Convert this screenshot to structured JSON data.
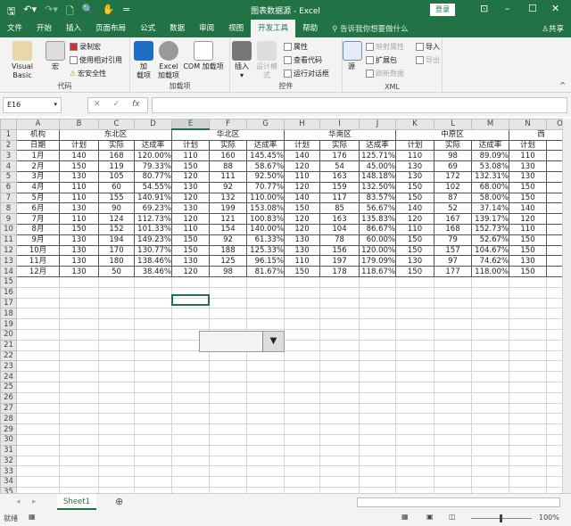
{
  "titlebar": {
    "title": "图表数据源  -  Excel",
    "login": "登录",
    "quick_access": [
      "save-icon",
      "undo-icon",
      "redo-icon",
      "new-icon",
      "print-preview-icon",
      "touch-mode-icon",
      "customize-icon"
    ]
  },
  "tabs": [
    "文件",
    "开始",
    "插入",
    "页面布局",
    "公式",
    "数据",
    "审阅",
    "视图",
    "开发工具",
    "帮助"
  ],
  "active_tab": "开发工具",
  "tell_me": "告诉我你想要做什么",
  "share": "共享",
  "ribbon": {
    "code": {
      "label": "代码",
      "visual_basic": "Visual Basic",
      "macro": "宏",
      "record": "录制宏",
      "relative": "使用相对引用",
      "security": "宏安全性"
    },
    "addins": {
      "label": "加载项",
      "addin": "加\n载项",
      "excel_addin": "Excel\n加载项",
      "com_addin": "COM 加载项"
    },
    "controls": {
      "label": "控件",
      "insert": "插入",
      "design": "设计模式",
      "properties": "属性",
      "view_code": "查看代码",
      "run_dialog": "运行对话框"
    },
    "xml": {
      "label": "XML",
      "source": "源",
      "map_props": "映射属性",
      "expansion": "扩展包",
      "refresh": "刷新数据",
      "import": "导入",
      "export": "导出"
    }
  },
  "formula": {
    "name_box": "E16",
    "cancel": "✕",
    "enter": "✓",
    "fx": "fx",
    "value": ""
  },
  "columns": [
    "A",
    "B",
    "C",
    "D",
    "E",
    "F",
    "G",
    "H",
    "I",
    "J",
    "K",
    "L",
    "M",
    "N",
    "O"
  ],
  "selected_column": "E",
  "header_row1": {
    "A": "机构",
    "regions": [
      "东北区",
      "华北区",
      "华南区",
      "中原区",
      "西"
    ]
  },
  "header_row2": [
    "日期",
    "计划",
    "实际",
    "达成率",
    "计划",
    "实际",
    "达成率",
    "计划",
    "实际",
    "达成率",
    "计划",
    "实际",
    "达成率",
    "计划"
  ],
  "rows": [
    [
      "1月",
      "140",
      "168",
      "120.00%",
      "110",
      "160",
      "145.45%",
      "140",
      "176",
      "125.71%",
      "110",
      "98",
      "89.09%",
      "110"
    ],
    [
      "2月",
      "150",
      "119",
      "79.33%",
      "150",
      "88",
      "58.67%",
      "120",
      "54",
      "45.00%",
      "130",
      "69",
      "53.08%",
      "130"
    ],
    [
      "3月",
      "130",
      "105",
      "80.77%",
      "120",
      "111",
      "92.50%",
      "110",
      "163",
      "148.18%",
      "130",
      "172",
      "132.31%",
      "130"
    ],
    [
      "4月",
      "110",
      "60",
      "54.55%",
      "130",
      "92",
      "70.77%",
      "120",
      "159",
      "132.50%",
      "150",
      "102",
      "68.00%",
      "150"
    ],
    [
      "5月",
      "110",
      "155",
      "140.91%",
      "120",
      "132",
      "110.00%",
      "140",
      "117",
      "83.57%",
      "150",
      "87",
      "58.00%",
      "150"
    ],
    [
      "6月",
      "130",
      "90",
      "69.23%",
      "130",
      "199",
      "153.08%",
      "150",
      "85",
      "56.67%",
      "140",
      "52",
      "37.14%",
      "140"
    ],
    [
      "7月",
      "110",
      "124",
      "112.73%",
      "120",
      "121",
      "100.83%",
      "120",
      "163",
      "135.83%",
      "120",
      "167",
      "139.17%",
      "120"
    ],
    [
      "8月",
      "150",
      "152",
      "101.33%",
      "110",
      "154",
      "140.00%",
      "120",
      "104",
      "86.67%",
      "110",
      "168",
      "152.73%",
      "110"
    ],
    [
      "9月",
      "130",
      "194",
      "149.23%",
      "150",
      "92",
      "61.33%",
      "130",
      "78",
      "60.00%",
      "150",
      "79",
      "52.67%",
      "150"
    ],
    [
      "10月",
      "130",
      "170",
      "130.77%",
      "150",
      "188",
      "125.33%",
      "130",
      "156",
      "120.00%",
      "150",
      "157",
      "104.67%",
      "150"
    ],
    [
      "11月",
      "130",
      "180",
      "138.46%",
      "130",
      "125",
      "96.15%",
      "110",
      "197",
      "179.09%",
      "130",
      "97",
      "74.62%",
      "130"
    ],
    [
      "12月",
      "130",
      "50",
      "38.46%",
      "120",
      "98",
      "81.67%",
      "150",
      "178",
      "118.67%",
      "150",
      "177",
      "118.00%",
      "150"
    ]
  ],
  "total_rows": 39,
  "sheet_tab": "Sheet1",
  "status": {
    "ready": "就绪",
    "zoom": "100%"
  },
  "colors": {
    "accent": "#217346"
  }
}
